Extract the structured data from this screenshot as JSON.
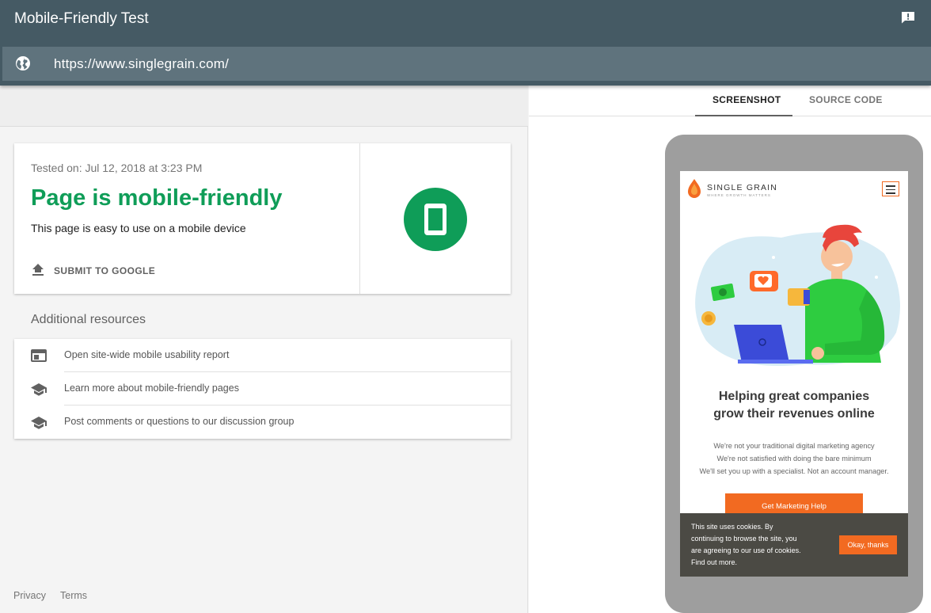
{
  "app": {
    "title": "Mobile-Friendly Test",
    "url": "https://www.singlegrain.com/"
  },
  "result": {
    "tested_on": "Tested on: Jul 12, 2018 at 3:23 PM",
    "verdict": "Page is mobile-friendly",
    "verdict_sub": "This page is easy to use on a mobile device",
    "submit_label": "SUBMIT TO GOOGLE",
    "status_color": "#0f9d58"
  },
  "resources": {
    "heading": "Additional resources",
    "items": [
      {
        "label": "Open site-wide mobile usability report",
        "icon": "web-report-icon"
      },
      {
        "label": "Learn more about mobile-friendly pages",
        "icon": "school-cap-icon"
      },
      {
        "label": "Post comments or questions to our discussion group",
        "icon": "school-cap-icon"
      }
    ]
  },
  "footer": {
    "privacy": "Privacy",
    "terms": "Terms"
  },
  "tabs": [
    {
      "label": "SCREENSHOT",
      "active": true
    },
    {
      "label": "SOURCE CODE",
      "active": false
    }
  ],
  "preview": {
    "brand": "SINGLE GRAIN",
    "tagline": "WHERE GROWTH MATTERS",
    "hero_line1": "Helping great companies",
    "hero_line2": "grow their revenues online",
    "desc_line1": "We're not your traditional digital marketing agency",
    "desc_line2": "We're not satisfied with doing the bare minimum",
    "desc_line3": "We'll set you up with a specialist. Not an account manager.",
    "cta": "Get Marketing Help",
    "cookie_line1": "This site uses cookies. By",
    "cookie_line2": "continuing to browse the site, you",
    "cookie_line3": "are agreeing to our use of cookies.",
    "cookie_line4": "Find out more.",
    "cookie_button": "Okay, thanks",
    "accent_color": "#f26a21"
  }
}
